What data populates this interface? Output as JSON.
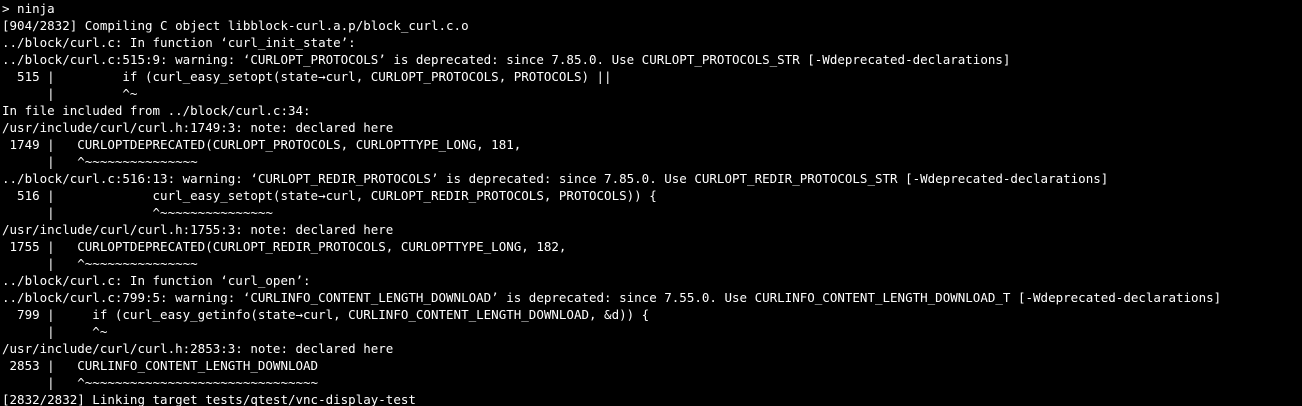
{
  "terminal": {
    "lines": [
      "> ninja",
      "[904/2832] Compiling C object libblock-curl.a.p/block_curl.c.o",
      "../block/curl.c: In function ‘curl_init_state’:",
      "../block/curl.c:515:9: warning: ‘CURLOPT_PROTOCOLS’ is deprecated: since 7.85.0. Use CURLOPT_PROTOCOLS_STR [-Wdeprecated-declarations]",
      "  515 |         if (curl_easy_setopt(state→curl, CURLOPT_PROTOCOLS, PROTOCOLS) ||",
      "      |         ^~",
      "In file included from ../block/curl.c:34:",
      "/usr/include/curl/curl.h:1749:3: note: declared here",
      " 1749 |   CURLOPTDEPRECATED(CURLOPT_PROTOCOLS, CURLOPTTYPE_LONG, 181,",
      "      |   ^~~~~~~~~~~~~~~~",
      "../block/curl.c:516:13: warning: ‘CURLOPT_REDIR_PROTOCOLS’ is deprecated: since 7.85.0. Use CURLOPT_REDIR_PROTOCOLS_STR [-Wdeprecated-declarations]",
      "  516 |             curl_easy_setopt(state→curl, CURLOPT_REDIR_PROTOCOLS, PROTOCOLS)) {",
      "      |             ^~~~~~~~~~~~~~~~",
      "/usr/include/curl/curl.h:1755:3: note: declared here",
      " 1755 |   CURLOPTDEPRECATED(CURLOPT_REDIR_PROTOCOLS, CURLOPTTYPE_LONG, 182,",
      "      |   ^~~~~~~~~~~~~~~~",
      "../block/curl.c: In function ‘curl_open’:",
      "../block/curl.c:799:5: warning: ‘CURLINFO_CONTENT_LENGTH_DOWNLOAD’ is deprecated: since 7.55.0. Use CURLINFO_CONTENT_LENGTH_DOWNLOAD_T [-Wdeprecated-declarations]",
      "  799 |     if (curl_easy_getinfo(state→curl, CURLINFO_CONTENT_LENGTH_DOWNLOAD, &d)) {",
      "      |     ^~",
      "/usr/include/curl/curl.h:2853:3: note: declared here",
      " 2853 |   CURLINFO_CONTENT_LENGTH_DOWNLOAD",
      "      |   ^~~~~~~~~~~~~~~~~~~~~~~~~~~~~~~~",
      "[2832/2832] Linking target tests/qtest/vnc-display-test"
    ]
  }
}
